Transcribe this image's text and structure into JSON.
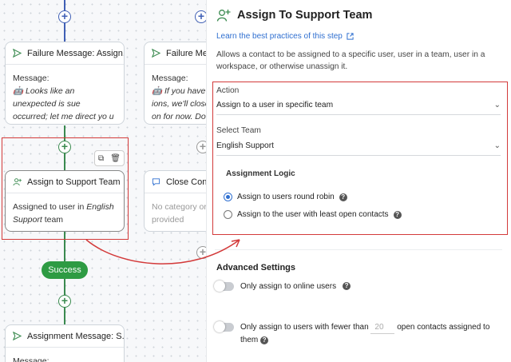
{
  "canvas": {
    "failure_card": {
      "title": "Failure Message: Assign...",
      "label": "Message:",
      "text": "Looks like an unexpected is sue occurred; let me direct yo u to an agent with expertise."
    },
    "failure_card_2": {
      "title": "Failure Messa",
      "label": "Message:",
      "text": "If you have r ions, we'll close on for now. Do"
    },
    "assign_card": {
      "title": "Assign to Support Team",
      "text_prefix": "Assigned to user in",
      "team": "English Support",
      "text_suffix": "team"
    },
    "close_card": {
      "title": "Close Conv",
      "text": "No category or provided"
    },
    "success_label": "Success",
    "assignment_card": {
      "title": "Assignment Message: S...",
      "label": "Message:"
    }
  },
  "panel": {
    "title": "Assign To Support Team",
    "learn_link": "Learn the best practices of this step",
    "description": "Allows a contact to be assigned to a specific user, user in a team, user in a workspace, or otherwise unassign it.",
    "action": {
      "label": "Action",
      "value": "Assign to a user in specific team"
    },
    "select_team": {
      "label": "Select Team",
      "value": "English Support"
    },
    "assignment_logic": {
      "label": "Assignment Logic",
      "options": [
        {
          "label": "Assign to users round robin",
          "selected": true
        },
        {
          "label": "Assign to the user with least open contacts",
          "selected": false
        }
      ]
    },
    "advanced": {
      "title": "Advanced Settings",
      "online_only": {
        "label": "Only assign to online users",
        "enabled": false
      },
      "fewer_than": {
        "label_before": "Only assign to users with fewer than",
        "value": "20",
        "label_after": "open contacts assigned to them",
        "enabled": false
      }
    }
  },
  "colors": {
    "accent": "#2f6fd0",
    "success": "#2e9b43",
    "highlight": "#d33a3a",
    "flow_line_blue": "#3f5fb5",
    "flow_line_green": "#3a8a4f"
  }
}
